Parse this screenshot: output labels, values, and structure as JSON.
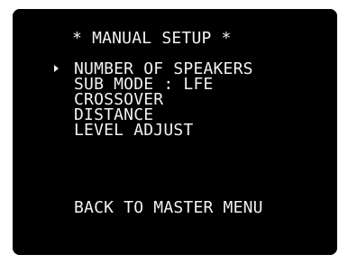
{
  "osd": {
    "title": "* MANUAL SETUP *",
    "selected_index": 0,
    "cursor_icon": "triangle-right-icon",
    "colors": {
      "background": "#000000",
      "text": "#f2f2f2"
    },
    "menu": [
      {
        "label": "NUMBER OF SPEAKERS"
      },
      {
        "label": "SUB MODE : LFE"
      },
      {
        "label": "CROSSOVER"
      },
      {
        "label": "DISTANCE"
      },
      {
        "label": "LEVEL ADJUST"
      }
    ],
    "back_label": "BACK TO MASTER MENU"
  }
}
